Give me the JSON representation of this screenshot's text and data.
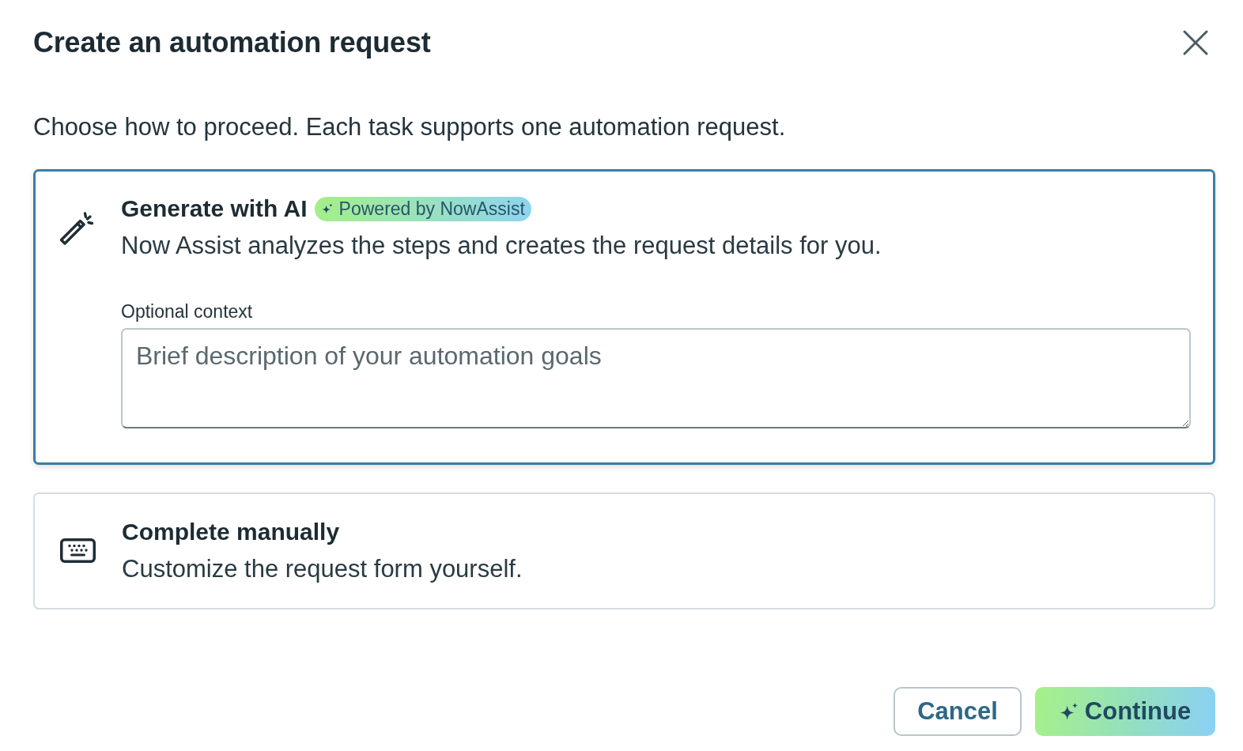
{
  "dialog": {
    "title": "Create an automation request",
    "intro": "Choose how to proceed. Each task supports one automation request."
  },
  "options": [
    {
      "kind": "ai",
      "title": "Generate with AI",
      "badge": "Powered by NowAssist",
      "description": "Now Assist analyzes the steps and creates the request details for you.",
      "selected": true,
      "field": {
        "label": "Optional context",
        "placeholder": "Brief description of your automation goals"
      }
    },
    {
      "kind": "manual",
      "title": "Complete manually",
      "description": "Customize the request form yourself.",
      "selected": false
    }
  ],
  "buttons": [
    {
      "kind": "secondary",
      "label": "Cancel"
    },
    {
      "kind": "primary",
      "label": "Continue"
    }
  ]
}
